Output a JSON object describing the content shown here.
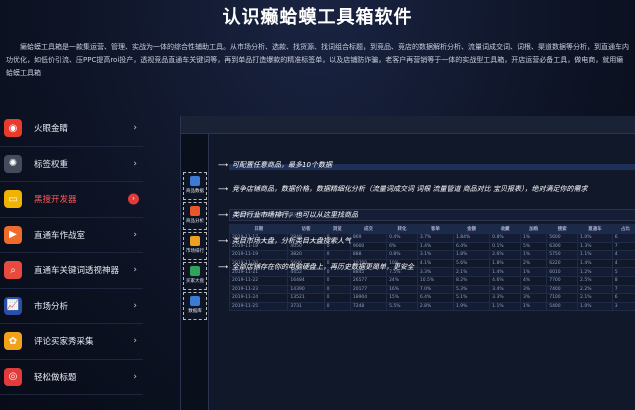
{
  "header": {
    "title": "认识癞蛤蟆工具箱软件",
    "description": "癞蛤蟆工具箱是一款集运营、管理、实战为一体的综合性辅助工具。从市场分析、选款、找货源、找词组合标题，到竞品、竞店的数据解析分析、流量词成交词、词根、渠道数据等分析，到直通车内功优化，如低价引流、压PPC提高roi投产，透视竞品直通车关键词等，再到单品打造爆款的精准标签单，以及店铺防诈骗，老客户再营销等于一体的实战型工具箱，开店运营必备工具，做电商，就用癞蛤蟆工具箱"
  },
  "sidebar": {
    "items": [
      {
        "label": "火眼金睛",
        "icon": "fire-eye-icon",
        "color": "#e83b2e",
        "glyph": "◉"
      },
      {
        "label": "标签权重",
        "icon": "film-reel-icon",
        "color": "#444b5c",
        "glyph": "✺"
      },
      {
        "label": "黑搜开发器",
        "icon": "laptop-icon",
        "color": "#f0b400",
        "glyph": "▭"
      },
      {
        "label": "直通车作战室",
        "icon": "car-icon",
        "color": "#f06a2a",
        "glyph": "▶"
      },
      {
        "label": "直通车关键词透视神器",
        "icon": "magnifier-icon",
        "color": "#e94a3f",
        "glyph": "⌕"
      },
      {
        "label": "市场分析",
        "icon": "chart-icon",
        "color": "#2a4fa8",
        "glyph": "📈"
      },
      {
        "label": "评论买家秀采集",
        "icon": "flower-icon",
        "color": "#f2a21a",
        "glyph": "✿"
      },
      {
        "label": "轻松做标题",
        "icon": "target-icon",
        "color": "#e23b3b",
        "glyph": "◎"
      }
    ],
    "active_index": 2
  },
  "screenshot": {
    "tools": [
      {
        "label": "商品数据",
        "color": "#3a7bd5"
      },
      {
        "label": "商品分析",
        "color": "#e8562a"
      },
      {
        "label": "市场排行",
        "color": "#f0a020"
      },
      {
        "label": "买家大盘",
        "color": "#2fa35a"
      },
      {
        "label": "数据库",
        "color": "#3a7bd5"
      }
    ],
    "notes": [
      {
        "text": "可配置任意商品，最多10个数据",
        "hl": ""
      },
      {
        "text": "竞争店铺商品，数据价格，数据精细化分析（流量词成交词 词根 流量管道 商品对比 宝贝报表），绝对满足你的需求",
        "hl": "商品对比"
      },
      {
        "text": "类目行业市场排行，也可以从这里找商品",
        "hl": ""
      },
      {
        "text": "类目市场大盘，分析类目大盘搜索人气",
        "hl": ""
      },
      {
        "text": "全部店铺存在你的电脑硬盘上，再历史数据更简单，更安全",
        "hl": ""
      }
    ],
    "filter_label": "年份 月份 时间 展开记录 所属分类",
    "table": {
      "headers": [
        "日期",
        "访客",
        "浏览",
        "成交",
        "转化",
        "客单",
        "金额",
        "收藏",
        "加购",
        "搜索",
        "直通车",
        "占比"
      ],
      "rows": [
        [
          "2019-11-17",
          "2848",
          "0",
          "869",
          "0.4%",
          "3.7%",
          "1.84%",
          "0.8%",
          "1%",
          "5600",
          "1.0%",
          "6"
        ],
        [
          "2019-11-18",
          "4050",
          "0",
          "9000",
          "6%",
          "1.4%",
          "6.4%",
          "0.1%",
          "5%",
          "6300",
          "1.3%",
          "7"
        ],
        [
          "2019-11-19",
          "3820",
          "0",
          "888",
          "0.8%",
          "3.1%",
          "1.8%",
          "2.6%",
          "1%",
          "5750",
          "1.1%",
          "4"
        ],
        [
          "2019-11-20",
          "5600",
          "0",
          "10700",
          "10%",
          "4.1%",
          "5.6%",
          "1.8%",
          "2%",
          "6220",
          "1.4%",
          "4"
        ],
        [
          "2019-11-21",
          "4452",
          "0",
          "8845",
          "7.5%",
          "3.3%",
          "2.1%",
          "1.4%",
          "1%",
          "6010",
          "1.2%",
          "5"
        ],
        [
          "2019-11-22",
          "16484",
          "0",
          "26577",
          "24%",
          "10.5%",
          "8.2%",
          "4.6%",
          "4%",
          "7700",
          "2.5%",
          "8"
        ],
        [
          "2019-11-23",
          "14390",
          "0",
          "20177",
          "16%",
          "7.0%",
          "5.3%",
          "3.4%",
          "3%",
          "7400",
          "2.2%",
          "7"
        ],
        [
          "2019-11-24",
          "13521",
          "0",
          "18904",
          "15%",
          "6.4%",
          "5.1%",
          "3.3%",
          "3%",
          "7100",
          "2.1%",
          "6"
        ],
        [
          "2019-11-25",
          "3731",
          "0",
          "7248",
          "5.5%",
          "2.8%",
          "1.9%",
          "1.1%",
          "1%",
          "5400",
          "1.0%",
          "3"
        ]
      ]
    }
  }
}
